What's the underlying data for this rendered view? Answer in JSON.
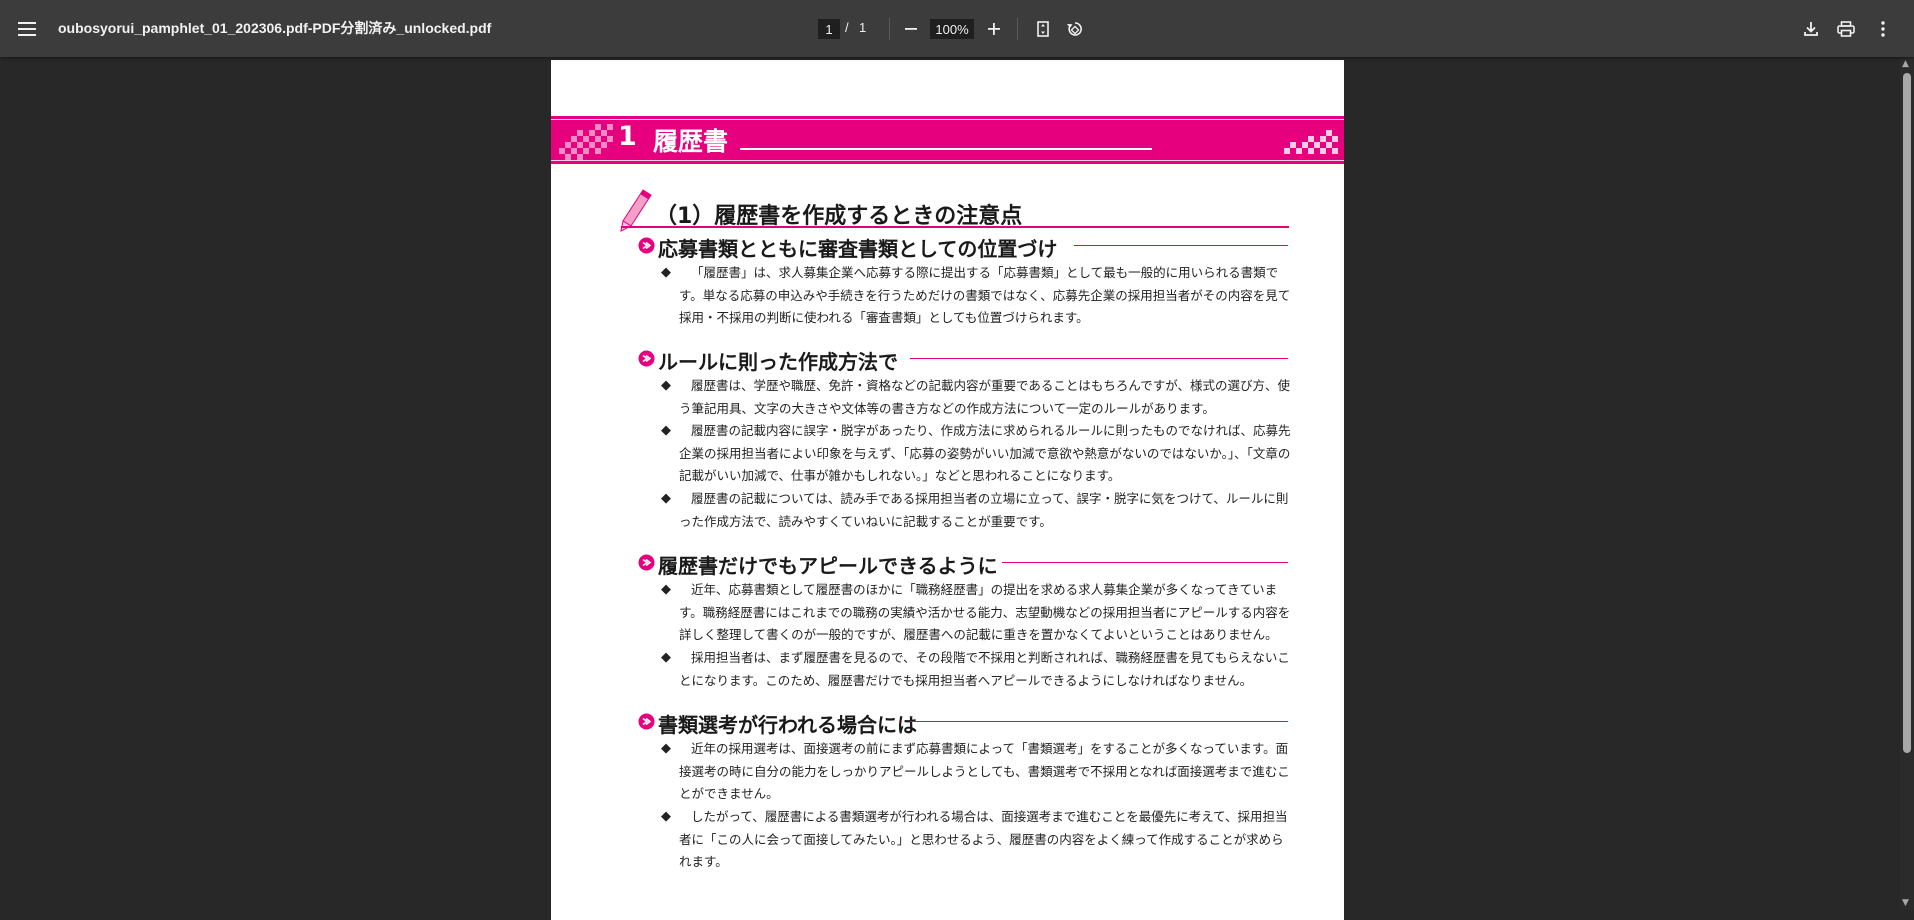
{
  "toolbar": {
    "title": "oubosyorui_pamphlet_01_202306.pdf-PDF分割済み_unlocked.pdf",
    "page_current": "1",
    "page_separator": "/",
    "page_total": "1",
    "zoom": "100%"
  },
  "icons": {
    "menu": "menu-icon",
    "zoom_out": "minus-icon",
    "zoom_in": "plus-icon",
    "fit": "fit-page-icon",
    "rotate": "rotate-icon",
    "download": "download-icon",
    "print": "print-icon",
    "more": "more-vert-icon"
  },
  "colors": {
    "accent": "#e6007e",
    "toolbar": "#3c3c3c",
    "viewer_bg": "#282828"
  },
  "document": {
    "chapter_number": "1",
    "chapter_title": "履歴書",
    "section_title": "（1）履歴書を作成するときの注意点",
    "subsections": [
      {
        "title": "応募書類とともに審査書類としての位置づけ",
        "bullets": [
          "「履歴書」は、求人募集企業へ応募する際に提出する「応募書類」として最も一般的に用いられる書類です。単なる応募の申込みや手続きを行うためだけの書類ではなく、応募先企業の採用担当者がその内容を見て採用・不採用の判断に使われる「審査書類」としても位置づけられます。"
        ]
      },
      {
        "title": "ルールに則った作成方法で",
        "bullets": [
          "履歴書は、学歴や職歴、免許・資格などの記載内容が重要であることはもちろんですが、様式の選び方、使う筆記用具、文字の大きさや文体等の書き方などの作成方法について一定のルールがあります。",
          "履歴書の記載内容に誤字・脱字があったり、作成方法に求められるルールに則ったものでなければ、応募先企業の採用担当者によい印象を与えず、「応募の姿勢がいい加減で意欲や熱意がないのではないか。」、「文章の記載がいい加減で、仕事が雑かもしれない。」などと思われることになります。",
          "履歴書の記載については、読み手である採用担当者の立場に立って、誤字・脱字に気をつけて、ルールに則った作成方法で、読みやすくていねいに記載することが重要です。"
        ]
      },
      {
        "title": "履歴書だけでもアピールできるように",
        "bullets": [
          "近年、応募書類として履歴書のほかに「職務経歴書」の提出を求める求人募集企業が多くなってきています。職務経歴書にはこれまでの職務の実績や活かせる能力、志望動機などの採用担当者にアピールする内容を詳しく整理して書くのが一般的ですが、履歴書への記載に重きを置かなくてよいということはありません。",
          "採用担当者は、まず履歴書を見るので、その段階で不採用と判断されれば、職務経歴書を見てもらえないことになります。このため、履歴書だけでも採用担当者へアピールできるようにしなければなりません。"
        ]
      },
      {
        "title": "書類選考が行われる場合には",
        "bullets": [
          "近年の採用選考は、面接選考の前にまず応募書類によって「書類選考」をすることが多くなっています。面接選考の時に自分の能力をしっかりアピールしようとしても、書類選考で不採用となれば面接選考まで進むことができません。",
          "したがって、履歴書による書類選考が行われる場合は、面接選考まで進むことを最優先に考えて、採用担当者に「この人に会って面接してみたい。」と思わせるよう、履歴書の内容をよく練って作成することが求められます。"
        ]
      }
    ],
    "bullet_mark": "◆"
  }
}
